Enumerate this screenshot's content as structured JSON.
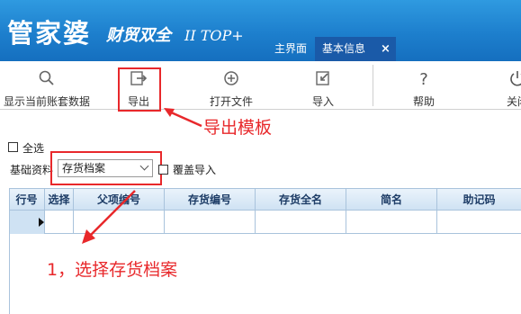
{
  "app": {
    "logo_main": "管家婆",
    "logo_sub": "财贸双全",
    "logo_version": "II TOP+"
  },
  "tabs": [
    {
      "label": "主界面"
    },
    {
      "label": "基本信息"
    }
  ],
  "tab_close_glyph": "×",
  "toolbar": {
    "items": [
      {
        "label": "显示当前账套数据",
        "icon": "search-icon"
      },
      {
        "label": "导出",
        "icon": "export-icon"
      },
      {
        "label": "打开文件",
        "icon": "open-file-icon"
      },
      {
        "label": "导入",
        "icon": "import-icon"
      },
      {
        "label": "帮助",
        "icon": "help-icon"
      },
      {
        "label": "关闭",
        "icon": "power-icon"
      }
    ]
  },
  "annotations": {
    "export_template": "导出模板",
    "select_inventory": "1，选择存货档案"
  },
  "filter": {
    "select_all_label": "全选",
    "basic_data_label": "基础资料",
    "basic_data_value": "存货档案",
    "overwrite_import_label": "覆盖导入"
  },
  "grid": {
    "columns": [
      "行号",
      "选择",
      "父项编号",
      "存货编号",
      "存货全名",
      "简名",
      "助记码"
    ]
  },
  "colors": {
    "header_blue": "#1d7fcd",
    "annotation_red": "#e8282b",
    "grid_header": "#cfe2f3"
  }
}
